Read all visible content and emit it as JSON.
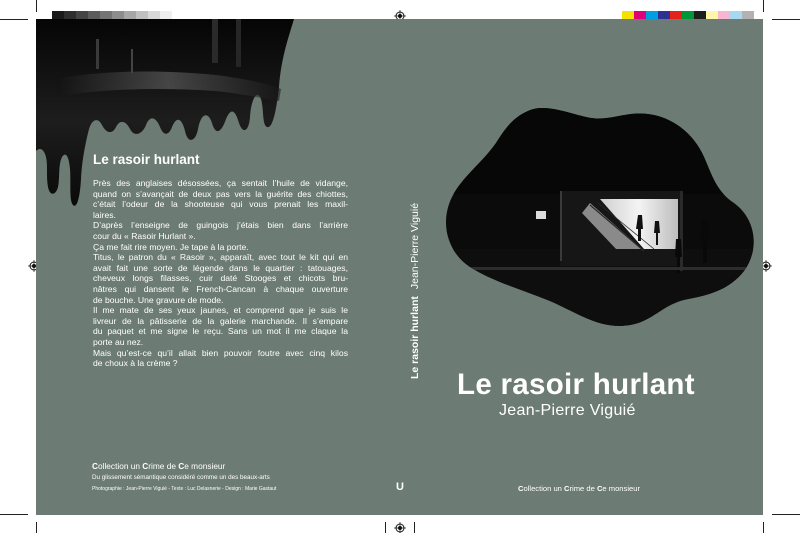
{
  "colors": {
    "cover": "#6c7b73",
    "text": "#ffffff",
    "photo_dark": "#0c0c0c"
  },
  "gray_swatches": [
    "#1a1a1a",
    "#2f2f2f",
    "#454545",
    "#5c5c5c",
    "#747474",
    "#8c8c8c",
    "#a6a6a6",
    "#bfbfbf",
    "#d8d8d8",
    "#efefef"
  ],
  "color_swatches": [
    "#f4e200",
    "#e0007a",
    "#00a0e0",
    "#2e3192",
    "#e3231b",
    "#009639",
    "#1d1d1b",
    "#fff6a8",
    "#f7b6d2",
    "#a6d9f0",
    "#b2b2b2"
  ],
  "back": {
    "title": "Le rasoir hurlant",
    "paragraph_lines": [
      "Près des anglaises désossées, ça sentait l’huile de vidange,",
      "quand on s’avançait de deux pas vers la guérite des chiottes,",
      "c’était l’odeur de la shooteuse qui vous prenait les maxil-",
      "laires.",
      "D’après l’enseigne de guingois j’étais bien dans l’arrière",
      "cour du « Rasoir Hurlant ».",
      "Ça me fait rire moyen. Je tape à la porte.",
      "Titus, le patron du « Rasoir », apparaît, avec tout le kit qui en",
      "avait fait une sorte de légende dans le quartier : tatouages,",
      "cheveux longs filasses, cuir daté Stooges et chicots bru-",
      "nâtres qui dansent le French-Cancan à chaque ouverture",
      "de bouche. Une gravure de mode.",
      "Il me mate de ses yeux jaunes, et comprend que je suis le",
      "livreur de la pâtisserie de la galerie marchande. Il s’empare",
      "du paquet et me signe le reçu. Sans un mot il me claque la",
      "porte au nez.",
      "Mais qu’est-ce qu’il allait bien pouvoir foutre avec cinq kilos",
      "de choux à la crème ?"
    ],
    "collection": {
      "c1": "C",
      "w1": "ollection un ",
      "c2": "C",
      "w2": "rime de ",
      "c3": "C",
      "w3": "e monsieur"
    },
    "tagline": "Du glissement sémantique considéré comme un des beaux-arts",
    "credits": "Photographie : Jean-Pierre Viguié - Texte : Luc Delasnerie - Design : Marie Gastaut"
  },
  "spine": {
    "title": "Le rasoir hurlant",
    "author": "Jean-Pierre Viguié",
    "logo": "U"
  },
  "front": {
    "title": "Le rasoir hurlant",
    "author": "Jean-Pierre Viguié",
    "collection": {
      "c1": "C",
      "w1": "ollection un ",
      "c2": "C",
      "w2": "rime de ",
      "c3": "C",
      "w3": "e monsieur"
    }
  }
}
